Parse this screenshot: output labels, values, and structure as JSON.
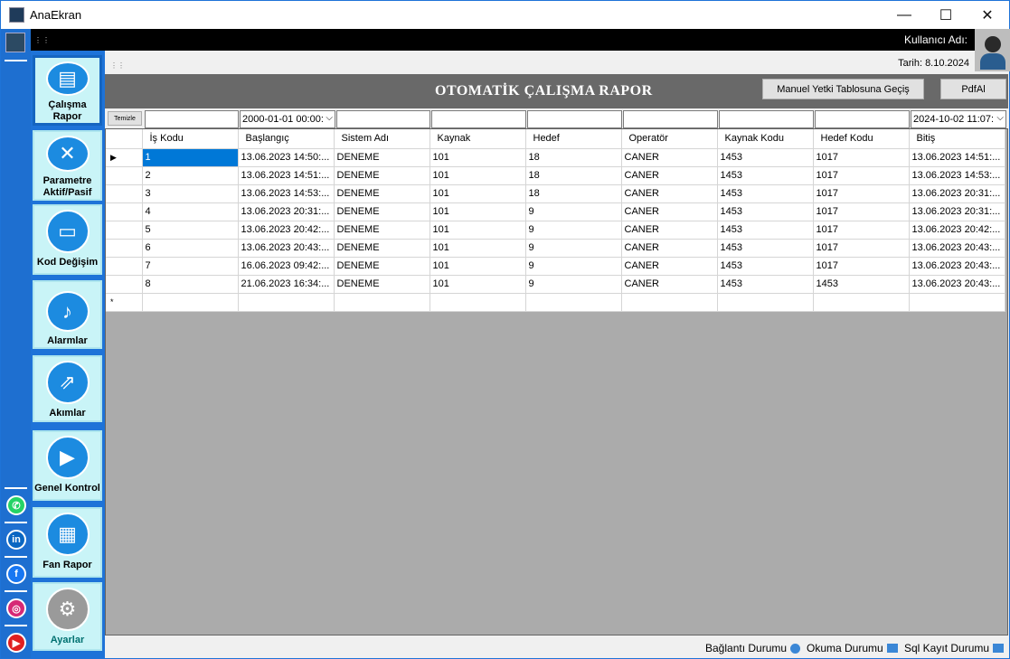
{
  "window": {
    "title": "AnaEkran",
    "minimize": "—",
    "maximize": "☐",
    "close": "✕"
  },
  "topbar": {
    "user_label": "Kullanıcı Adı:",
    "date_label": "Tarih: 8.10.2024"
  },
  "menu": {
    "items": [
      {
        "label": "Çalışma Rapor",
        "icon": "document-icon",
        "active": true
      },
      {
        "label": "Parametre Aktif/Pasif",
        "icon": "tools-icon"
      },
      {
        "label": "Kod Değişim",
        "icon": "card-icon"
      },
      {
        "label": "Alarmlar",
        "icon": "bell-icon"
      },
      {
        "label": "Akımlar",
        "icon": "chart-icon"
      },
      {
        "label": "Genel Kontrol",
        "icon": "video-icon"
      },
      {
        "label": "Fan Rapor",
        "icon": "gift-icon"
      },
      {
        "label": "Ayarlar",
        "icon": "gear-icon"
      }
    ]
  },
  "social": [
    "whatsapp-icon",
    "linkedin-icon",
    "facebook-icon",
    "instagram-icon",
    "youtube-icon"
  ],
  "header": {
    "title": "OTOMATİK ÇALIŞMA RAPOR",
    "manuel_button": "Manuel Yetki Tablosuna Geçiş",
    "pdf_button": "PdfAl"
  },
  "filters": {
    "clear_button": "Temizle",
    "start_date": "2000-01-01 00:00:",
    "end_date": "2024-10-02 11:07:"
  },
  "grid": {
    "columns": [
      "İş Kodu",
      "Başlangıç",
      "Sistem Adı",
      "Kaynak",
      "Hedef",
      "Operatör",
      "Kaynak Kodu",
      "Hedef Kodu",
      "Bitiş"
    ],
    "rows": [
      [
        "1",
        "13.06.2023 14:50:...",
        "DENEME",
        "101",
        "18",
        "CANER",
        "1453",
        "1017",
        "13.06.2023 14:51:..."
      ],
      [
        "2",
        "13.06.2023 14:51:...",
        "DENEME",
        "101",
        "18",
        "CANER",
        "1453",
        "1017",
        "13.06.2023 14:53:..."
      ],
      [
        "3",
        "13.06.2023 14:53:...",
        "DENEME",
        "101",
        "18",
        "CANER",
        "1453",
        "1017",
        "13.06.2023 20:31:..."
      ],
      [
        "4",
        "13.06.2023 20:31:...",
        "DENEME",
        "101",
        "9",
        "CANER",
        "1453",
        "1017",
        "13.06.2023 20:31:..."
      ],
      [
        "5",
        "13.06.2023 20:42:...",
        "DENEME",
        "101",
        "9",
        "CANER",
        "1453",
        "1017",
        "13.06.2023 20:42:..."
      ],
      [
        "6",
        "13.06.2023 20:43:...",
        "DENEME",
        "101",
        "9",
        "CANER",
        "1453",
        "1017",
        "13.06.2023 20:43:..."
      ],
      [
        "7",
        "16.06.2023 09:42:...",
        "DENEME",
        "101",
        "9",
        "CANER",
        "1453",
        "1017",
        "13.06.2023 20:43:..."
      ],
      [
        "8",
        "21.06.2023 16:34:...",
        "DENEME",
        "101",
        "9",
        "CANER",
        "1453",
        "1453",
        "13.06.2023 20:43:..."
      ]
    ],
    "current_row_marker": "▶",
    "new_row_marker": "*"
  },
  "status": {
    "connection": "Bağlantı Durumu",
    "read": "Okuma Durumu",
    "sql": "Sql Kayıt Durumu"
  },
  "colors": {
    "accent": "#1e73d8",
    "header_bg": "#696969",
    "menu_button_bg": "#c9f4f7",
    "selection": "#0078d7"
  }
}
